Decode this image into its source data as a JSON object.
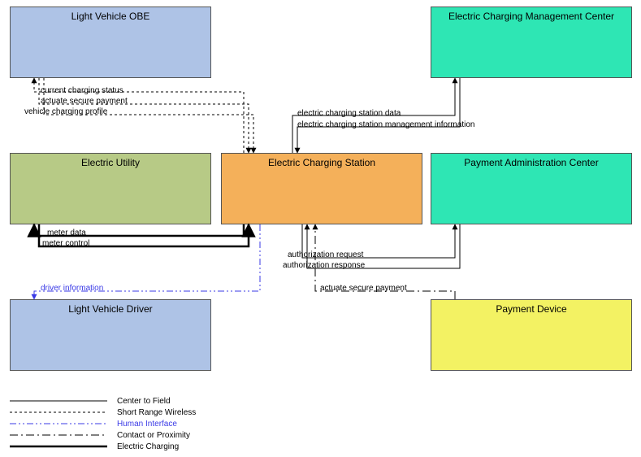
{
  "boxes": {
    "light_vehicle_obe": {
      "label": "Light Vehicle OBE",
      "color": "#aec3e6"
    },
    "ec_mgmt_center": {
      "label": "Electric Charging Management Center",
      "color": "#2ee6b4"
    },
    "electric_utility": {
      "label": "Electric Utility",
      "color": "#b7ca86"
    },
    "charging_station": {
      "label": "Electric Charging Station",
      "color": "#f4b05a"
    },
    "payment_admin": {
      "label": "Payment Administration Center",
      "color": "#2ee6b4"
    },
    "light_vehicle_driver": {
      "label": "Light Vehicle Driver",
      "color": "#aec3e6"
    },
    "payment_device": {
      "label": "Payment Device",
      "color": "#f3f263"
    }
  },
  "flows": {
    "current_charging_status": "current charging status",
    "actuate_secure_payment_obe": "actuate secure payment",
    "vehicle_charging_profile": "vehicle charging profile",
    "ec_station_data": "electric charging station data",
    "ec_station_mgmt_info": "electric charging station management information",
    "meter_data": "meter data",
    "meter_control": "meter control",
    "authorization_request": "authorization request",
    "authorization_response": "authorization response",
    "driver_information": "driver information",
    "actuate_secure_payment_device": "actuate secure payment"
  },
  "legend": {
    "center_to_field": "Center to Field",
    "short_range_wireless": "Short Range Wireless",
    "human_interface": "Human Interface",
    "contact_or_proximity": "Contact or Proximity",
    "electric_charging": "Electric Charging"
  },
  "chart_data": {
    "type": "diagram",
    "nodes": [
      "Light Vehicle OBE",
      "Electric Charging Management Center",
      "Electric Utility",
      "Electric Charging Station",
      "Payment Administration Center",
      "Light Vehicle Driver",
      "Payment Device"
    ],
    "edges": [
      {
        "from": "Electric Charging Station",
        "to": "Light Vehicle OBE",
        "label": "current charging status",
        "type": "Short Range Wireless"
      },
      {
        "from": "Light Vehicle OBE",
        "to": "Electric Charging Station",
        "label": "actuate secure payment",
        "type": "Short Range Wireless"
      },
      {
        "from": "Light Vehicle OBE",
        "to": "Electric Charging Station",
        "label": "vehicle charging profile",
        "type": "Short Range Wireless"
      },
      {
        "from": "Electric Charging Station",
        "to": "Electric Charging Management Center",
        "label": "electric charging station data",
        "type": "Center to Field"
      },
      {
        "from": "Electric Charging Management Center",
        "to": "Electric Charging Station",
        "label": "electric charging station management information",
        "type": "Center to Field"
      },
      {
        "from": "Electric Charging Station",
        "to": "Electric Utility",
        "label": "meter data",
        "type": "Electric Charging"
      },
      {
        "from": "Electric Utility",
        "to": "Electric Charging Station",
        "label": "meter control",
        "type": "Electric Charging"
      },
      {
        "from": "Electric Charging Station",
        "to": "Payment Administration Center",
        "label": "authorization request",
        "type": "Center to Field"
      },
      {
        "from": "Payment Administration Center",
        "to": "Electric Charging Station",
        "label": "authorization response",
        "type": "Center to Field"
      },
      {
        "from": "Electric Charging Station",
        "to": "Light Vehicle Driver",
        "label": "driver information",
        "type": "Human Interface"
      },
      {
        "from": "Payment Device",
        "to": "Electric Charging Station",
        "label": "actuate secure payment",
        "type": "Contact or Proximity"
      }
    ],
    "legend": [
      {
        "style": "solid-thin",
        "label": "Center to Field"
      },
      {
        "style": "dotted",
        "label": "Short Range Wireless"
      },
      {
        "style": "dash-dot-dot-blue",
        "label": "Human Interface"
      },
      {
        "style": "dash-dot",
        "label": "Contact or Proximity"
      },
      {
        "style": "solid-thick",
        "label": "Electric Charging"
      }
    ]
  }
}
